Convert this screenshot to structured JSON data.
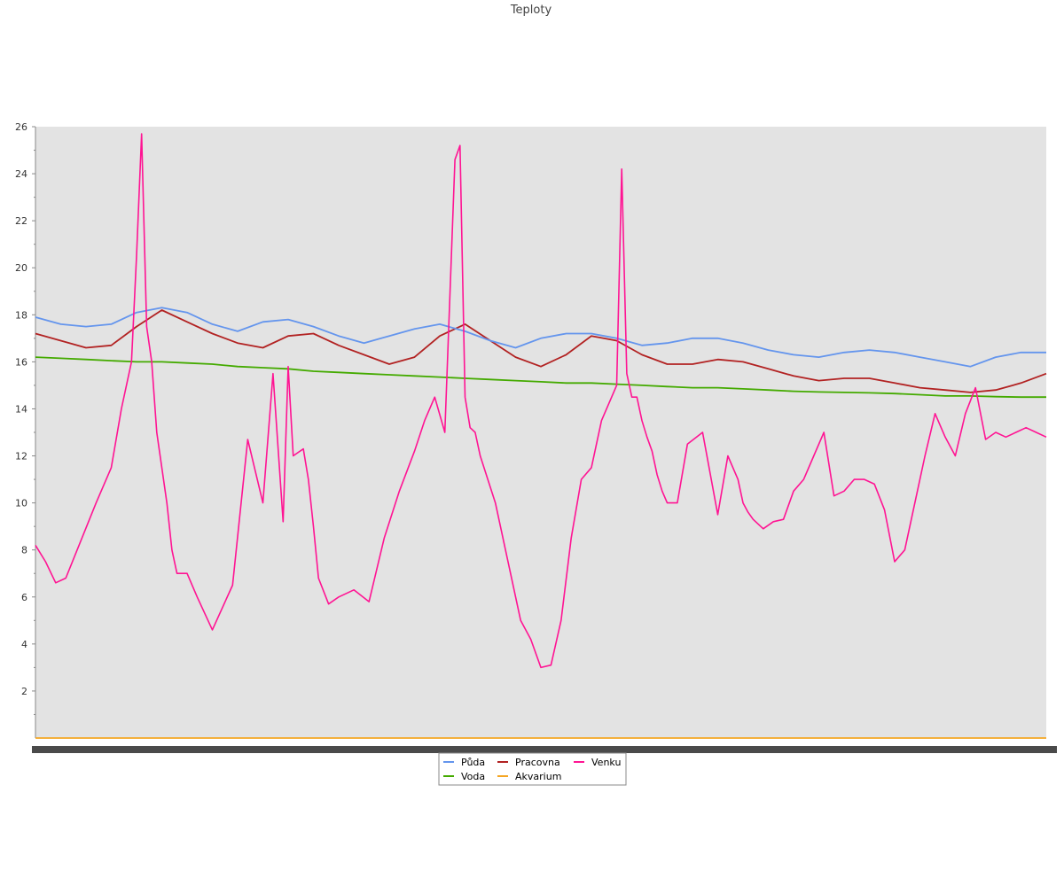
{
  "chart_data": {
    "type": "line",
    "title": "Teploty",
    "xlabel": "",
    "ylabel": "",
    "ylim": [
      0,
      26
    ],
    "yticks": [
      2,
      4,
      6,
      8,
      10,
      12,
      14,
      16,
      18,
      20,
      22,
      24,
      26
    ],
    "grid": false,
    "legend_position": "bottom",
    "x": [
      0,
      0.025,
      0.05,
      0.075,
      0.1,
      0.125,
      0.15,
      0.175,
      0.2,
      0.225,
      0.25,
      0.275,
      0.3,
      0.325,
      0.35,
      0.375,
      0.4,
      0.425,
      0.45,
      0.475,
      0.5,
      0.525,
      0.55,
      0.575,
      0.6,
      0.625,
      0.65,
      0.675,
      0.7,
      0.725,
      0.75,
      0.775,
      0.8,
      0.825,
      0.85,
      0.875,
      0.9,
      0.925,
      0.95,
      0.975,
      1
    ],
    "series": [
      {
        "name": "Půda",
        "color": "#6495ed",
        "values": [
          17.9,
          17.6,
          17.5,
          17.6,
          18.1,
          18.3,
          18.1,
          17.6,
          17.3,
          17.7,
          17.8,
          17.5,
          17.1,
          16.8,
          17.1,
          17.4,
          17.6,
          17.3,
          16.9,
          16.6,
          17.0,
          17.2,
          17.2,
          17.0,
          16.7,
          16.8,
          17.0,
          17.0,
          16.8,
          16.5,
          16.3,
          16.2,
          16.4,
          16.5,
          16.4,
          16.2,
          16.0,
          15.8,
          16.2,
          16.4,
          16.4
        ]
      },
      {
        "name": "Pracovna",
        "color": "#b22222",
        "values": [
          17.2,
          16.9,
          16.6,
          16.7,
          17.5,
          18.2,
          17.7,
          17.2,
          16.8,
          16.6,
          17.1,
          17.2,
          16.7,
          16.3,
          15.9,
          16.2,
          17.1,
          17.6,
          16.9,
          16.2,
          15.8,
          16.3,
          17.1,
          16.9,
          16.3,
          15.9,
          15.9,
          16.1,
          16.0,
          15.7,
          15.4,
          15.2,
          15.3,
          15.3,
          15.1,
          14.9,
          14.8,
          14.7,
          14.8,
          15.1,
          15.5
        ]
      },
      {
        "name": "Voda",
        "color": "#44aa00",
        "values": [
          16.2,
          16.15,
          16.1,
          16.05,
          16.0,
          16.0,
          15.95,
          15.9,
          15.8,
          15.75,
          15.7,
          15.6,
          15.55,
          15.5,
          15.45,
          15.4,
          15.35,
          15.3,
          15.25,
          15.2,
          15.15,
          15.1,
          15.1,
          15.05,
          15.0,
          14.95,
          14.9,
          14.9,
          14.85,
          14.8,
          14.75,
          14.72,
          14.7,
          14.68,
          14.65,
          14.6,
          14.55,
          14.55,
          14.52,
          14.5,
          14.5
        ]
      },
      {
        "name": "Akvarium",
        "color": "#f5a623",
        "values": [
          0,
          0,
          0,
          0,
          0,
          0,
          0,
          0,
          0,
          0,
          0,
          0,
          0,
          0,
          0,
          0,
          0,
          0,
          0,
          0,
          0,
          0,
          0,
          0,
          0,
          0,
          0,
          0,
          0,
          0,
          0,
          0,
          0,
          0,
          0,
          0,
          0,
          0,
          0,
          0,
          0
        ]
      },
      {
        "name": "Venku",
        "color": "#ff1493",
        "x": [
          0,
          0.01,
          0.02,
          0.03,
          0.045,
          0.06,
          0.075,
          0.085,
          0.095,
          0.1,
          0.105,
          0.11,
          0.115,
          0.12,
          0.125,
          0.13,
          0.135,
          0.14,
          0.15,
          0.16,
          0.175,
          0.195,
          0.21,
          0.225,
          0.235,
          0.245,
          0.25,
          0.255,
          0.265,
          0.27,
          0.275,
          0.28,
          0.29,
          0.3,
          0.315,
          0.33,
          0.345,
          0.36,
          0.375,
          0.385,
          0.395,
          0.405,
          0.415,
          0.42,
          0.425,
          0.43,
          0.435,
          0.44,
          0.455,
          0.47,
          0.48,
          0.49,
          0.5,
          0.51,
          0.52,
          0.53,
          0.54,
          0.55,
          0.56,
          0.57,
          0.575,
          0.58,
          0.585,
          0.59,
          0.595,
          0.6,
          0.605,
          0.61,
          0.615,
          0.62,
          0.625,
          0.635,
          0.645,
          0.66,
          0.675,
          0.685,
          0.69,
          0.695,
          0.7,
          0.705,
          0.71,
          0.72,
          0.73,
          0.74,
          0.75,
          0.76,
          0.77,
          0.78,
          0.79,
          0.8,
          0.81,
          0.82,
          0.83,
          0.84,
          0.85,
          0.86,
          0.87,
          0.88,
          0.89,
          0.9,
          0.91,
          0.92,
          0.93,
          0.94,
          0.95,
          0.96,
          0.97,
          0.98,
          0.99,
          1.0
        ],
        "values": [
          8.2,
          7.5,
          6.6,
          6.8,
          8.4,
          10.0,
          11.5,
          14.0,
          16.0,
          20.5,
          25.7,
          17.5,
          16.0,
          13.0,
          11.5,
          10.0,
          8.0,
          7.0,
          7.0,
          6.0,
          4.6,
          6.5,
          12.7,
          10.0,
          15.5,
          9.2,
          15.8,
          12.0,
          12.3,
          11.0,
          9.0,
          6.8,
          5.7,
          6.0,
          6.3,
          5.8,
          8.5,
          10.5,
          12.2,
          13.5,
          14.5,
          13.0,
          24.6,
          25.2,
          14.5,
          13.2,
          13.0,
          12.0,
          10.0,
          7.0,
          5.0,
          4.2,
          3.0,
          3.1,
          5.0,
          8.5,
          11.0,
          11.5,
          13.5,
          14.5,
          15.0,
          24.2,
          15.5,
          14.5,
          14.5,
          13.5,
          12.8,
          12.2,
          11.2,
          10.5,
          10.0,
          10.0,
          12.5,
          13.0,
          9.5,
          12.0,
          11.5,
          11.0,
          10.0,
          9.6,
          9.3,
          8.9,
          9.2,
          9.3,
          10.5,
          11.0,
          12.0,
          13.0,
          10.3,
          10.5,
          11.0,
          11.0,
          10.8,
          9.7,
          7.5,
          8.0,
          10.0,
          12.0,
          13.8,
          12.8,
          12.0,
          13.8,
          14.9,
          12.7,
          13.0,
          12.8,
          13.0,
          13.2,
          13.0,
          12.8
        ]
      }
    ],
    "legend": [
      {
        "label": "Půda",
        "color": "#6495ed"
      },
      {
        "label": "Pracovna",
        "color": "#b22222"
      },
      {
        "label": "Venku",
        "color": "#ff1493"
      },
      {
        "label": "Voda",
        "color": "#44aa00"
      },
      {
        "label": "Akvarium",
        "color": "#f5a623"
      }
    ]
  }
}
